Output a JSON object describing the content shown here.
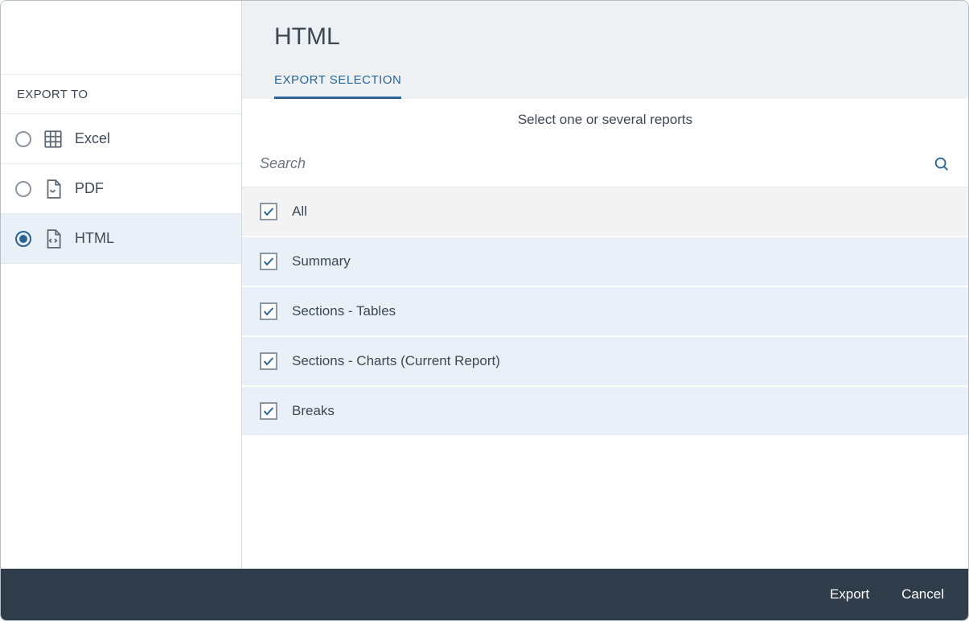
{
  "sidebar": {
    "header": "EXPORT TO",
    "formats": [
      {
        "label": "Excel",
        "selected": false
      },
      {
        "label": "PDF",
        "selected": false
      },
      {
        "label": "HTML",
        "selected": true
      }
    ]
  },
  "main": {
    "title": "HTML",
    "tab": "EXPORT SELECTION",
    "instruction": "Select one or several reports",
    "search_placeholder": "Search",
    "reports": [
      {
        "label": "All",
        "checked": true,
        "all": true
      },
      {
        "label": "Summary",
        "checked": true
      },
      {
        "label": "Sections - Tables",
        "checked": true
      },
      {
        "label": "Sections - Charts (Current Report)",
        "checked": true
      },
      {
        "label": "Breaks",
        "checked": true
      }
    ]
  },
  "footer": {
    "export": "Export",
    "cancel": "Cancel"
  }
}
